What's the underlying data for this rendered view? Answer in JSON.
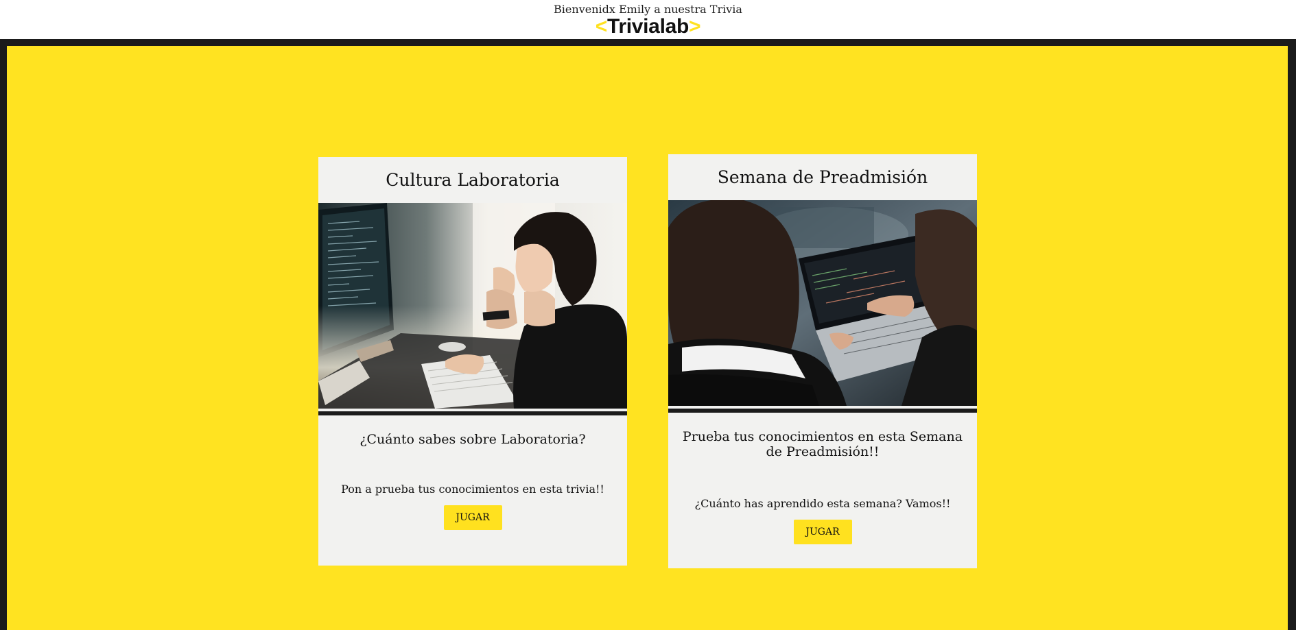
{
  "header": {
    "welcome": "Bienvenidx Emily a nuestra Trivia",
    "logo_left_bracket": "<",
    "logo_text": "Trivialab",
    "logo_right_bracket": ">"
  },
  "colors": {
    "accent": "#FFE321",
    "frame": "#1b1b1b",
    "card": "#f2f2f0"
  },
  "cards": [
    {
      "title": "Cultura Laboratoria",
      "subtitle": "¿Cuánto sabes sobre Laboratoria?",
      "description": "Pon a prueba tus conocimientos en esta trivia!!",
      "button": "JUGAR"
    },
    {
      "title": "Semana de Preadmisión",
      "subtitle": "Prueba tus conocimientos en esta Semana de Preadmisión!!",
      "description": "¿Cuánto has aprendido esta semana? Vamos!!",
      "button": "JUGAR"
    }
  ]
}
